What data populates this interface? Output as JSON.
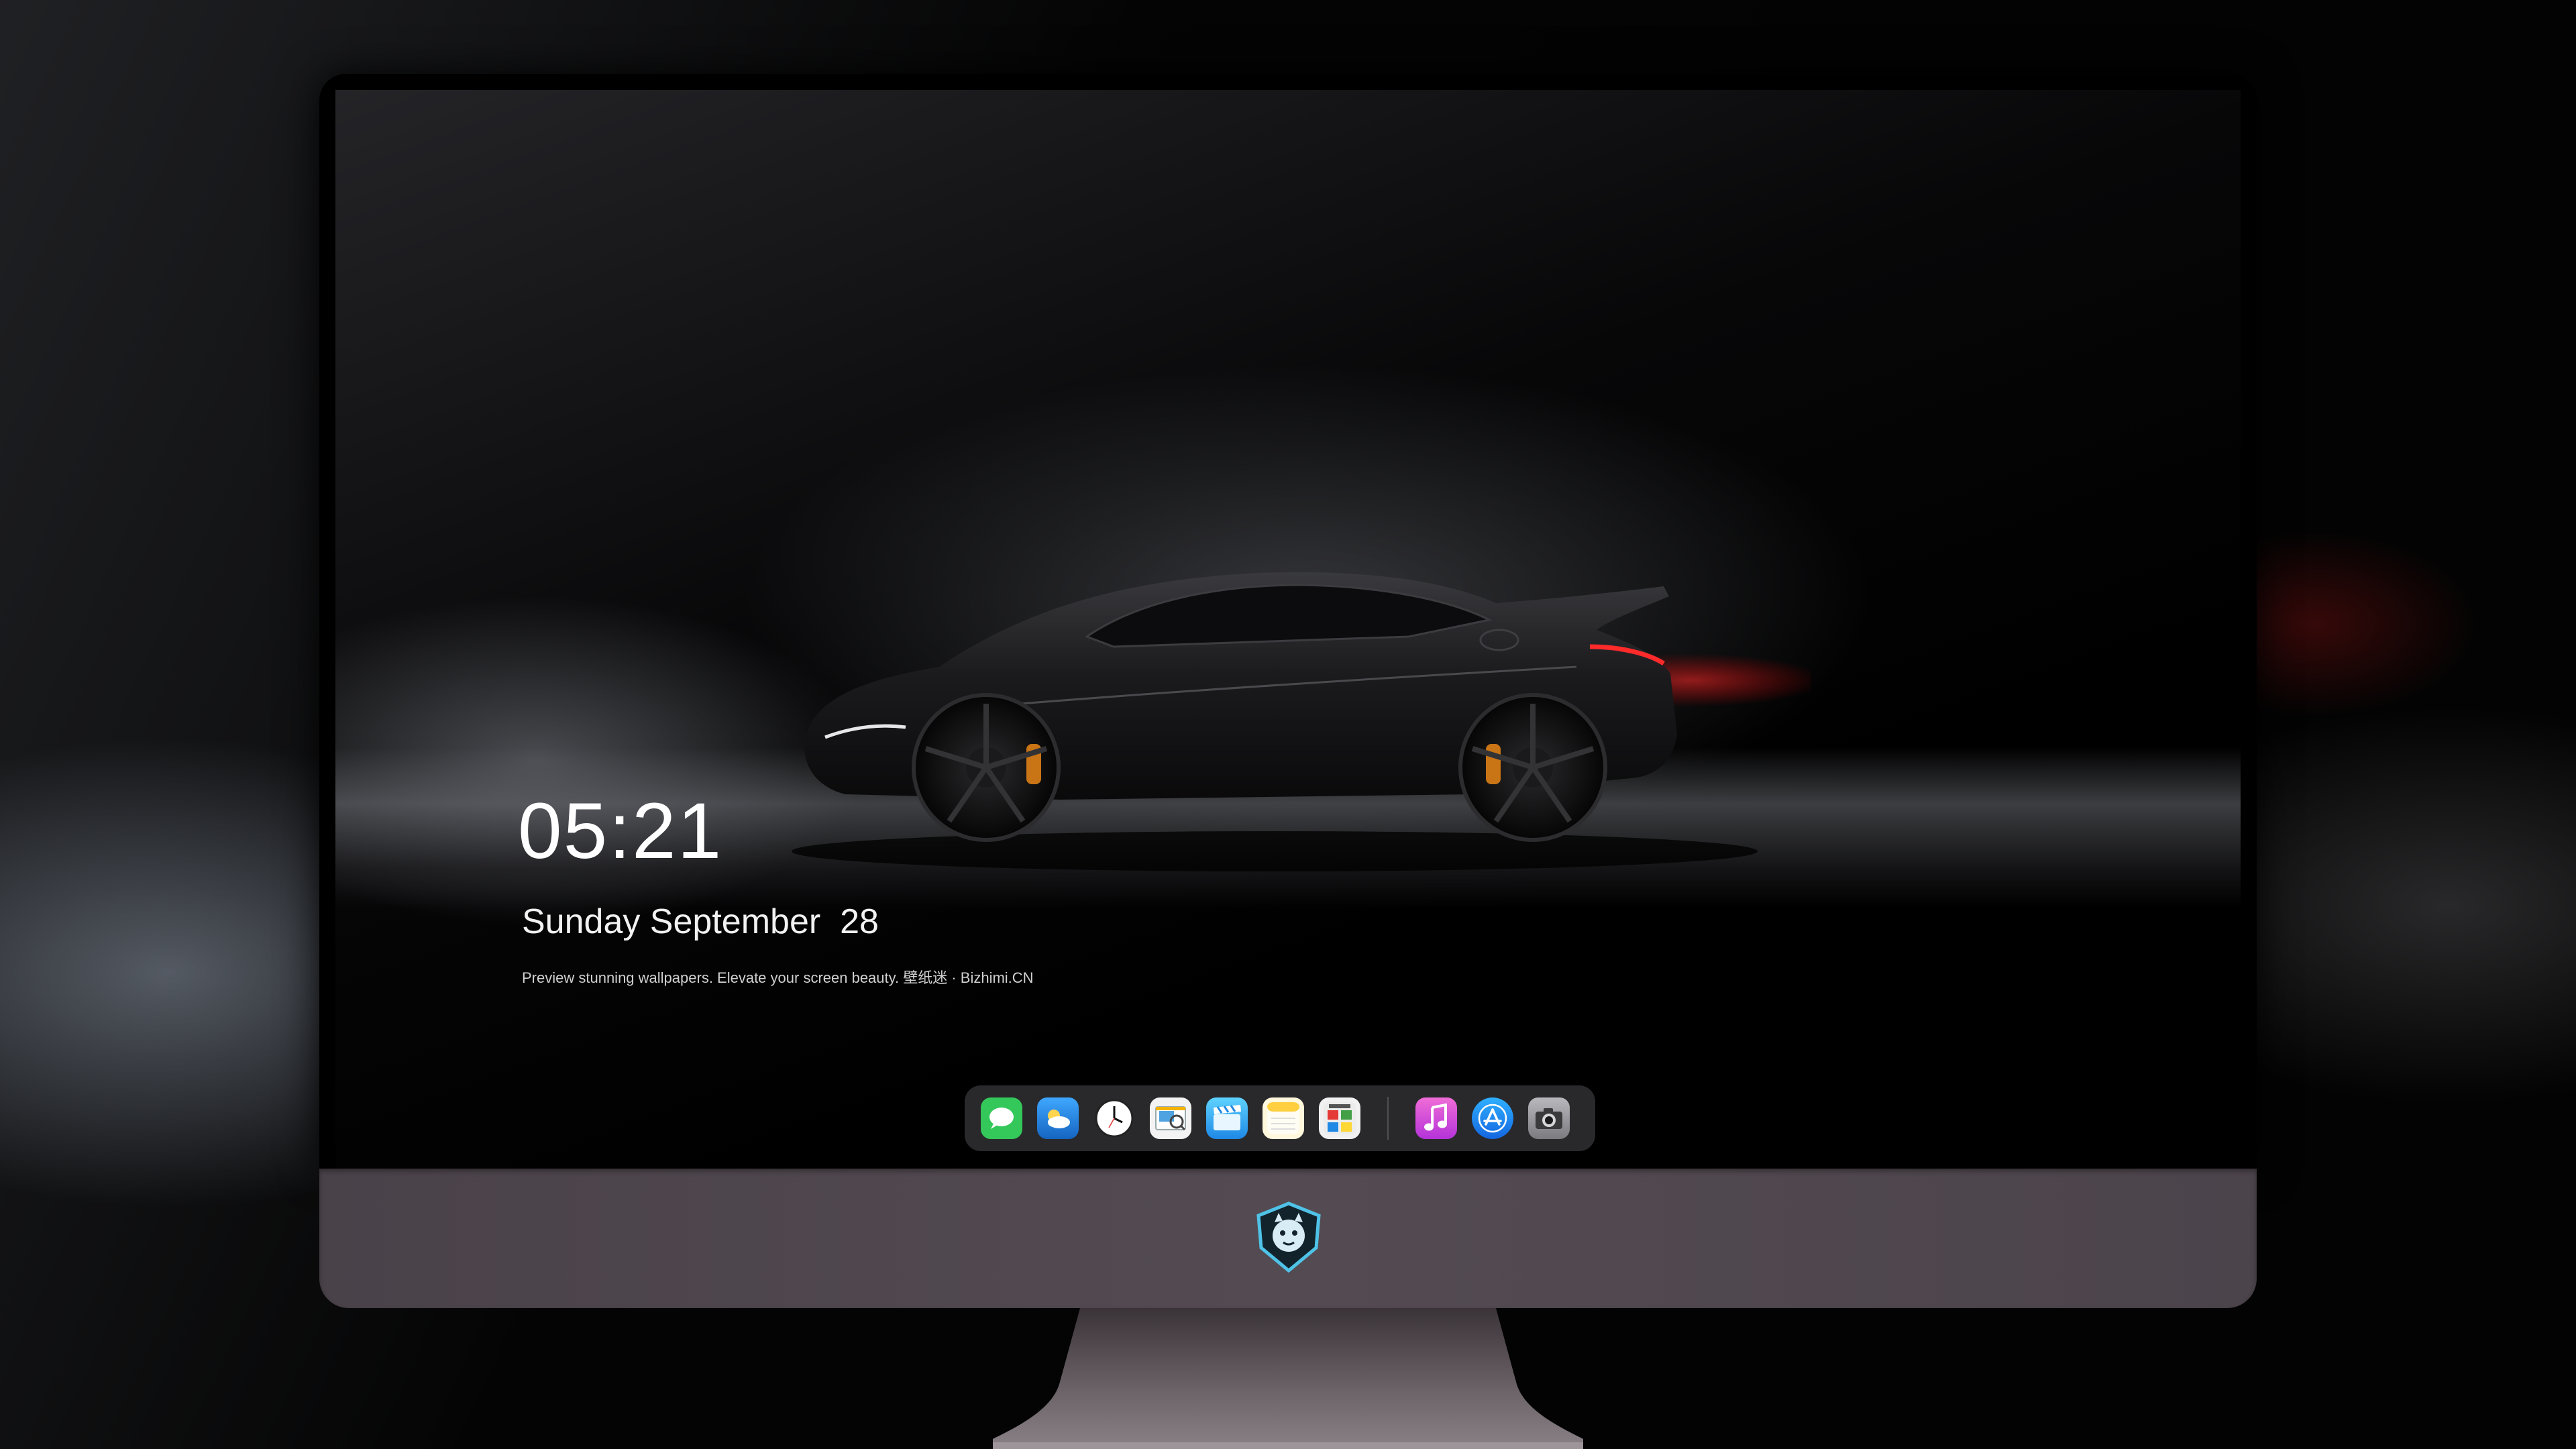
{
  "lockscreen": {
    "time": "05:21",
    "date": "Sunday September  28",
    "tagline": "Preview stunning wallpapers. Elevate your screen beauty. 壁纸迷 · Bizhimi.CN"
  },
  "dock": {
    "apps": [
      {
        "name": "messages-icon",
        "color": "#34c759"
      },
      {
        "name": "weather-icon",
        "color": "#1e88e5"
      },
      {
        "name": "clock-icon",
        "color": "#ffffff"
      },
      {
        "name": "preview-icon",
        "color": "#f5f5f5"
      },
      {
        "name": "clips-icon",
        "color": "#4fc3f7"
      },
      {
        "name": "notes-icon",
        "color": "#ffd54f"
      },
      {
        "name": "photo-booth-icon",
        "color": "#f5f5f5"
      },
      {
        "name": "music-icon",
        "color": "#d84fdc"
      },
      {
        "name": "app-store-icon",
        "color": "#1f8ef1"
      },
      {
        "name": "camera-icon",
        "color": "#8e8e93"
      }
    ]
  },
  "colors": {
    "monitor_chin": "#4f474e",
    "dock_bg": "#2d2d30",
    "accent_taillight": "#ff2a2a",
    "brake_caliper": "#d07a1a"
  }
}
